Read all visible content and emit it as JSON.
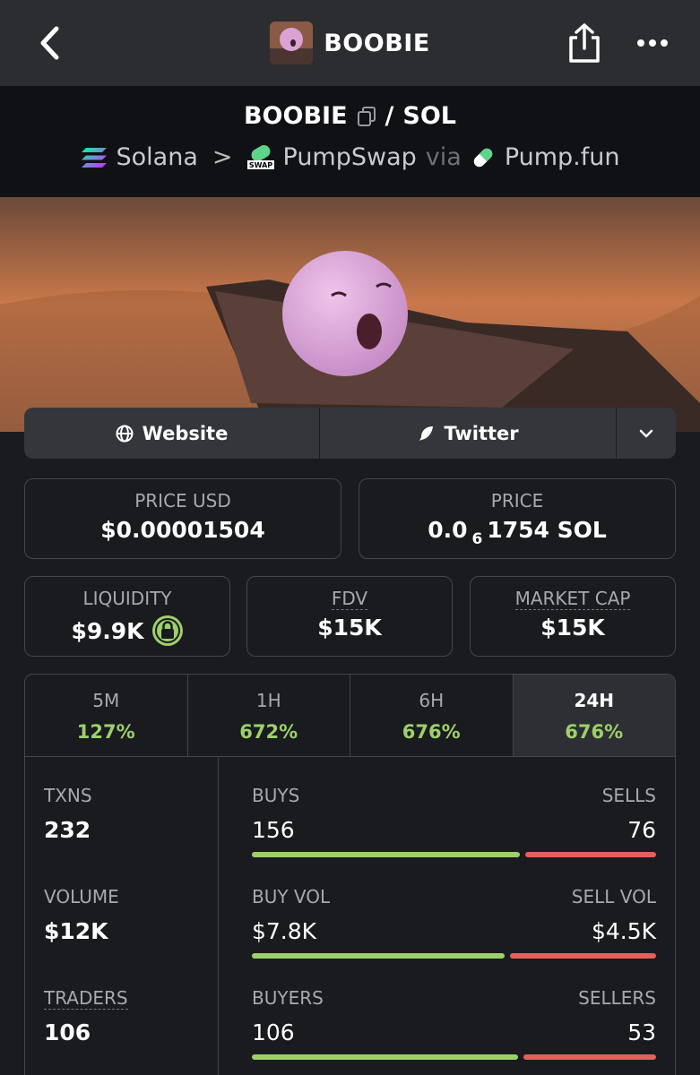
{
  "header": {
    "back_icon": "chevron-left-icon",
    "token_name": "BOOBIE",
    "share_icon": "share-icon",
    "more_icon": "more-dots-icon"
  },
  "pair": {
    "base": "BOOBIE",
    "slash": "/",
    "quote": "SOL",
    "chain": "Solana",
    "dex": "PumpSwap",
    "via": "via",
    "launchpad": "Pump.fun",
    "dex_badge": "SWAP"
  },
  "links": {
    "website": "Website",
    "twitter": "Twitter"
  },
  "price": {
    "usd_label": "PRICE USD",
    "usd_value": "$0.00001504",
    "native_label": "PRICE",
    "native_prefix": "0.0",
    "native_subscript": "6",
    "native_rest": "1754 SOL"
  },
  "metrics": {
    "liquidity_label": "LIQUIDITY",
    "liquidity_value": "$9.9K",
    "fdv_label": "FDV",
    "fdv_value": "$15K",
    "mcap_label": "MARKET CAP",
    "mcap_value": "$15K"
  },
  "tabs": [
    {
      "label": "5M",
      "value": "127%"
    },
    {
      "label": "1H",
      "value": "672%"
    },
    {
      "label": "6H",
      "value": "676%"
    },
    {
      "label": "24H",
      "value": "676%"
    }
  ],
  "active_tab": "24H",
  "stats": {
    "txns_label": "TXNS",
    "txns_value": "232",
    "volume_label": "VOLUME",
    "volume_value": "$12K",
    "traders_label": "TRADERS",
    "traders_value": "106",
    "buys_label": "BUYS",
    "buys_value": "156",
    "sells_label": "SELLS",
    "sells_value": "76",
    "buyvol_label": "BUY VOL",
    "buyvol_value": "$7.8K",
    "sellvol_label": "SELL VOL",
    "sellvol_value": "$4.5K",
    "buyers_label": "BUYERS",
    "buyers_value": "106",
    "sellers_label": "SELLERS",
    "sellers_value": "53"
  },
  "ratios": {
    "buys_share": 0.672,
    "buy_vol_share": 0.634,
    "buyers_share": 0.667
  },
  "colors": {
    "positive": "#9dd06a",
    "negative": "#e5605b",
    "background": "#1a1b1f"
  }
}
